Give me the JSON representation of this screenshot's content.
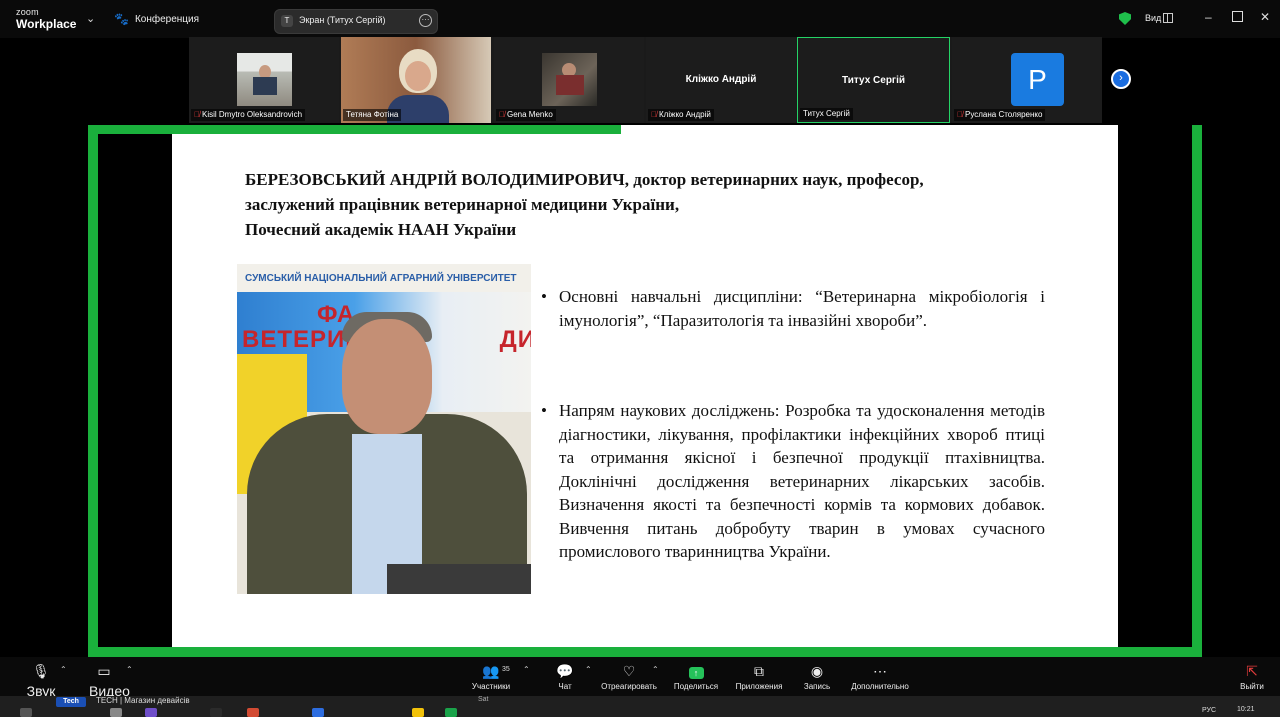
{
  "app": {
    "logo_line1": "zoom",
    "logo_line2": "Workplace",
    "meeting_label": "Конференция",
    "share_pill_initial": "T",
    "share_pill_label": "Экран (Титух Сергій)",
    "view_label": "Вид"
  },
  "gallery": {
    "tiles": [
      {
        "name": "Kisil Dmytro Oleksandrovich",
        "muted": true,
        "video": true
      },
      {
        "name": "Тетяна Фотіна",
        "muted": false,
        "video": true
      },
      {
        "name": "Gena Menko",
        "muted": true,
        "video": true
      },
      {
        "name": "Кліжко Андрій",
        "center_name": "Кліжко Андрій",
        "muted": true,
        "video": false
      },
      {
        "name": "Титух Сергій",
        "center_name": "Титух Сергій",
        "muted": false,
        "video": false,
        "active_speaker": true
      },
      {
        "name": "Руслана Столяренко",
        "avatar_letter": "P",
        "muted": true,
        "video": false
      }
    ]
  },
  "slide": {
    "title_lines": [
      "БЕРЕЗОВСЬКИЙ АНДРІЙ ВОЛОДИМИРОВИЧ, доктор ветеринарних наук, професор,",
      "заслужений працівник ветеринарної медицини України,",
      "Почесний академік НААН України"
    ],
    "photo_banner": "СУМСЬКИЙ НАЦІОНАЛЬНИЙ АГРАРНИЙ УНІВЕРСИТЕТ",
    "photo_text_1": "ФА",
    "photo_text_2": "ВЕТЕРИНА",
    "photo_text_3": "ДИЦИНИ",
    "bullets": [
      "Основні навчальні дисципліни: “Ветеринарна мікробіологія і імунологія”, “Паразитологія та інвазійні хвороби”.",
      "Напрям наукових досліджень: Розробка та удосконалення методів діагностики, лікування, профілактики інфекційних хвороб птиці та отримання якісної і безпечної продукції птахівництва. Доклінічні дослідження ветеринарних лікарських засобів. Визначення якості та безпечності кормів та кормових добавок. Вивчення питань добробуту тварин в умовах сучасного промислового тваринництва України."
    ]
  },
  "toolbar": {
    "audio": "Звук",
    "video": "Видео",
    "participants": "Участники",
    "participants_count": "35",
    "chat": "Чат",
    "react": "Отреагировать",
    "share": "Поделиться",
    "apps": "Приложения",
    "record": "Запись",
    "more": "Дополнительно",
    "leave": "Выйти"
  },
  "taskbar": {
    "tech_badge": "Tech",
    "window_title": "TECH | Магазин девайсів",
    "sat_label": "Sat",
    "lang": "РУС",
    "time": "10:21"
  },
  "colors": {
    "active_green": "#1ab03c",
    "mute_red": "#e23c3c",
    "avatar_blue": "#1a7be0",
    "zoom_blue": "#1a6de0"
  }
}
